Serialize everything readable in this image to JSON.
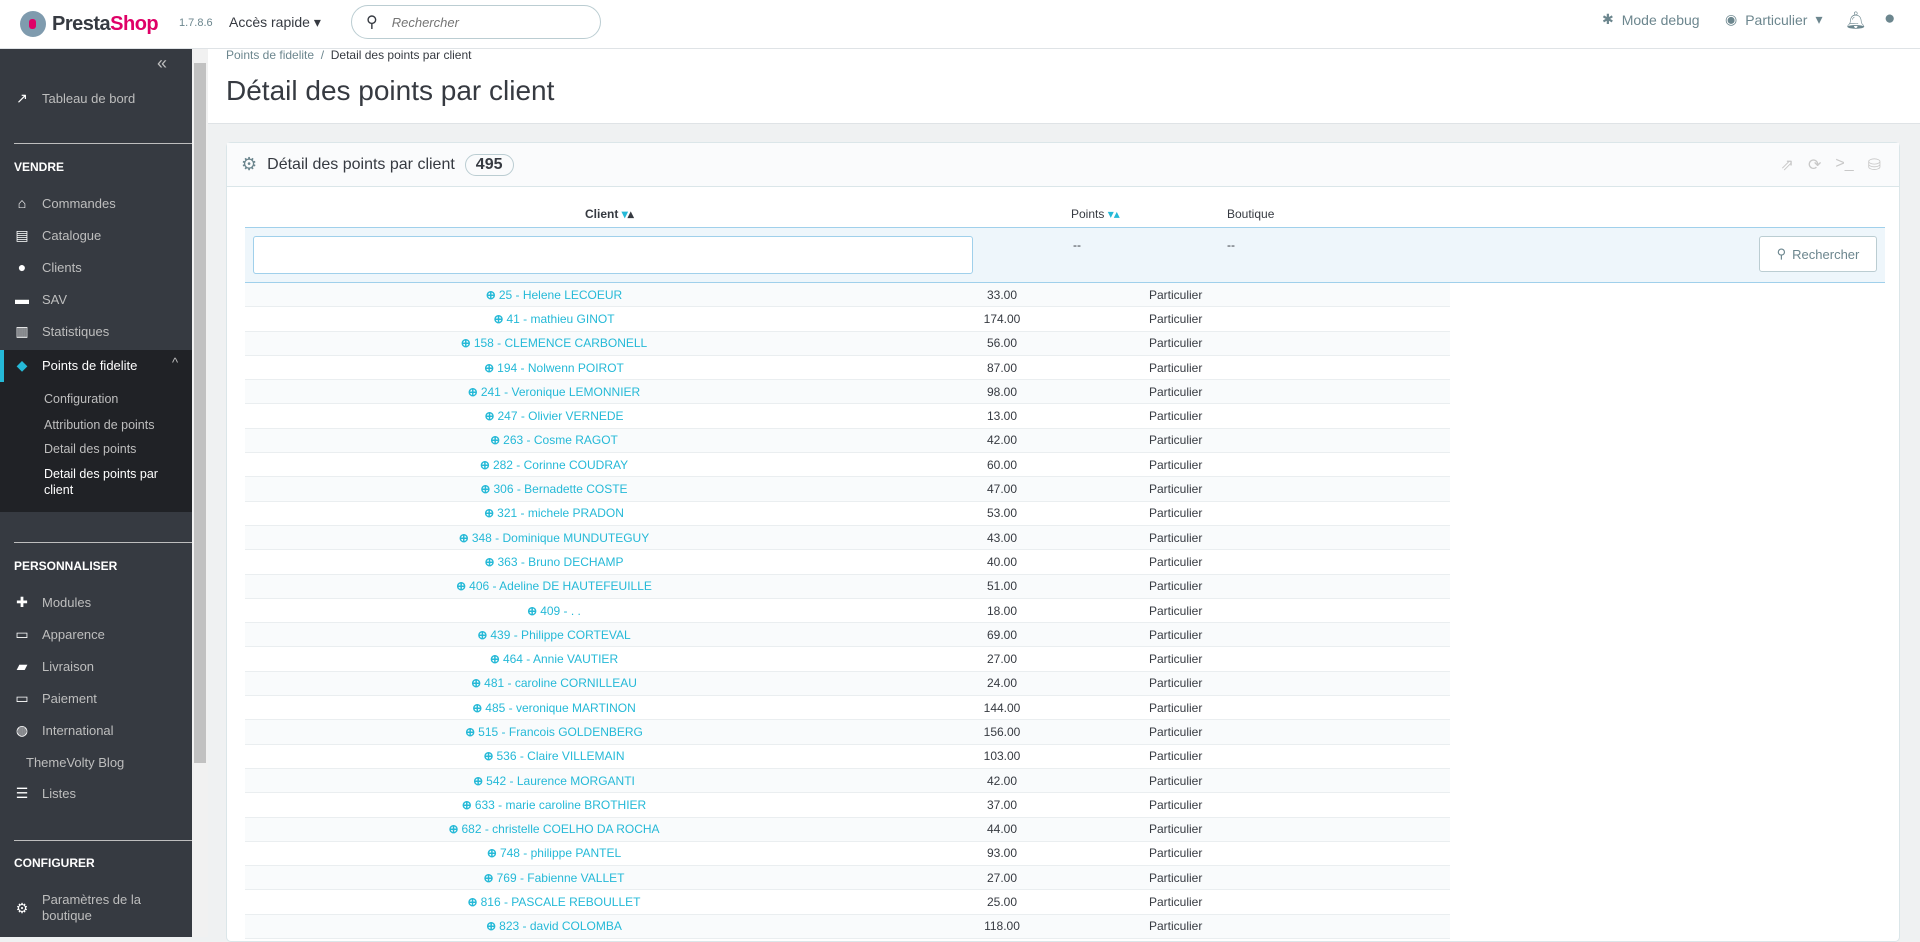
{
  "topbar": {
    "logo": "PrestaShop",
    "logo_a": "Presta",
    "logo_b": "Shop",
    "version": "1.7.8.6",
    "quick_access": "Accès rapide",
    "search_placeholder": "Rechercher",
    "debug": "Mode debug",
    "shop": "Particulier"
  },
  "sidebar": {
    "dashboard": "Tableau de bord",
    "sections": [
      "VENDRE",
      "PERSONNALISER",
      "CONFIGURER"
    ],
    "sell": [
      "Commandes",
      "Catalogue",
      "Clients",
      "SAV",
      "Statistiques"
    ],
    "active": "Points de fidelite",
    "sub": [
      "Configuration",
      "Attribution de points",
      "Detail des points",
      "Detail des points par client"
    ],
    "customize": [
      "Modules",
      "Apparence",
      "Livraison",
      "Paiement",
      "International",
      "ThemeVolty Blog",
      "Listes"
    ],
    "configure": [
      "Paramètres de la boutique"
    ]
  },
  "breadcrumb": {
    "parent": "Points de fidelite",
    "current": "Detail des points par client"
  },
  "page_title": "Détail des points par client",
  "panel": {
    "title": "Détail des points par client",
    "count": "495"
  },
  "table": {
    "headers": {
      "client": "Client",
      "points": "Points",
      "shop": "Boutique"
    },
    "filter": {
      "points": "--",
      "shop": "--",
      "search_button": "Rechercher"
    },
    "rows": [
      [
        "25 - Helene LECOEUR",
        "33.00",
        "Particulier"
      ],
      [
        "41 - mathieu GINOT",
        "174.00",
        "Particulier"
      ],
      [
        "158 - CLEMENCE CARBONELL",
        "56.00",
        "Particulier"
      ],
      [
        "194 - Nolwenn POIROT",
        "87.00",
        "Particulier"
      ],
      [
        "241 - Veronique LEMONNIER",
        "98.00",
        "Particulier"
      ],
      [
        "247 - Olivier VERNEDE",
        "13.00",
        "Particulier"
      ],
      [
        "263 - Cosme RAGOT",
        "42.00",
        "Particulier"
      ],
      [
        "282 - Corinne COUDRAY",
        "60.00",
        "Particulier"
      ],
      [
        "306 - Bernadette COSTE",
        "47.00",
        "Particulier"
      ],
      [
        "321 - michele PRADON",
        "53.00",
        "Particulier"
      ],
      [
        "348 - Dominique MUNDUTEGUY",
        "43.00",
        "Particulier"
      ],
      [
        "363 - Bruno DECHAMP",
        "40.00",
        "Particulier"
      ],
      [
        "406 - Adeline DE HAUTEFEUILLE",
        "51.00",
        "Particulier"
      ],
      [
        "409 - . .",
        "18.00",
        "Particulier"
      ],
      [
        "439 - Philippe CORTEVAL",
        "69.00",
        "Particulier"
      ],
      [
        "464 - Annie VAUTIER",
        "27.00",
        "Particulier"
      ],
      [
        "481 - caroline CORNILLEAU",
        "24.00",
        "Particulier"
      ],
      [
        "485 - veronique MARTINON",
        "144.00",
        "Particulier"
      ],
      [
        "515 - Francois GOLDENBERG",
        "156.00",
        "Particulier"
      ],
      [
        "536 - Claire VILLEMAIN",
        "103.00",
        "Particulier"
      ],
      [
        "542 - Laurence MORGANTI",
        "42.00",
        "Particulier"
      ],
      [
        "633 - marie caroline BROTHIER",
        "37.00",
        "Particulier"
      ],
      [
        "682 - christelle COELHO DA ROCHA",
        "44.00",
        "Particulier"
      ],
      [
        "748 - philippe PANTEL",
        "93.00",
        "Particulier"
      ],
      [
        "769 - Fabienne VALLET",
        "27.00",
        "Particulier"
      ],
      [
        "816 - PASCALE REBOULLET",
        "25.00",
        "Particulier"
      ],
      [
        "823 - david COLOMBA",
        "118.00",
        "Particulier"
      ]
    ]
  },
  "colors": {
    "accent": "#25b9d7",
    "sidebar": "#363a41",
    "brand": "#df0067"
  }
}
